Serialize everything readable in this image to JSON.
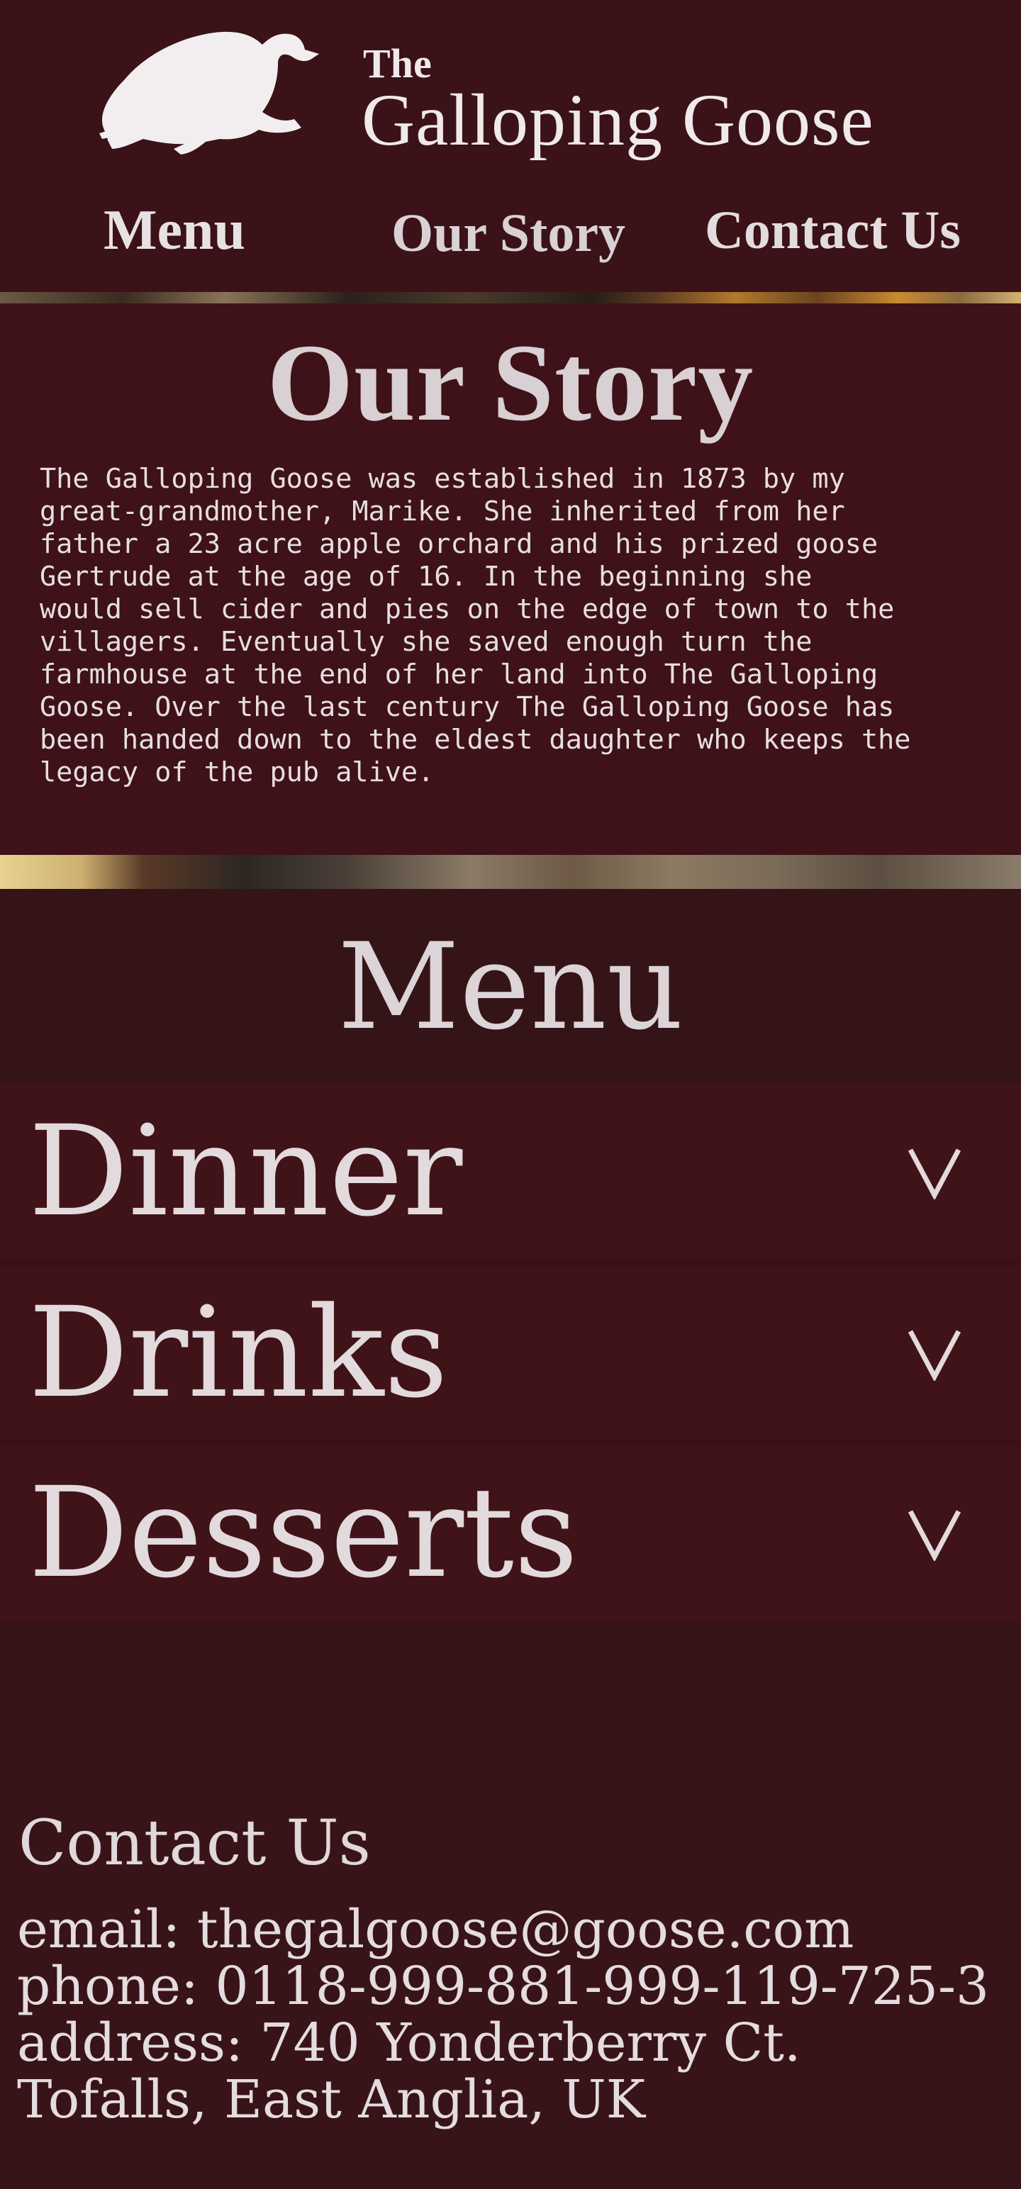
{
  "header": {
    "logo_the": "The",
    "logo_name": "Galloping Goose",
    "nav": {
      "menu": "Menu",
      "story": "Our Story",
      "contact": "Contact Us"
    }
  },
  "story": {
    "title": "Our Story",
    "text_lines": [
      "The Galloping Goose was established in 1873 by my",
      "great-grandmother, Marike. She inherited from her",
      "father a 23 acre apple orchard and his prized goose",
      "Gertrude at the age of 16. In the beginning she",
      "would sell cider and pies on the edge of town to the",
      "villagers. Eventually she saved enough turn the",
      "farmhouse at the end of her land into The Galloping",
      "Goose. Over the last century The Galloping Goose has",
      "been handed down to the eldest daughter who keeps the",
      "legacy of the pub alive."
    ]
  },
  "menu": {
    "title": "Menu",
    "sections": [
      {
        "label": "Dinner",
        "icon": "chevron-down-icon"
      },
      {
        "label": "Drinks",
        "icon": "chevron-down-icon"
      },
      {
        "label": "Desserts",
        "icon": "chevron-down-icon"
      }
    ]
  },
  "contact": {
    "title": "Contact Us",
    "email": "email: thegalgoose@goose.com",
    "phone": "phone: 0118-999-881-999-119-725-3",
    "address_line1": "address: 740 Yonderberry Ct.",
    "address_line2": "Tofalls, East Anglia, UK"
  },
  "colors": {
    "background": "#3a1318",
    "panel": "#401318",
    "text": "#ddd4d6"
  }
}
